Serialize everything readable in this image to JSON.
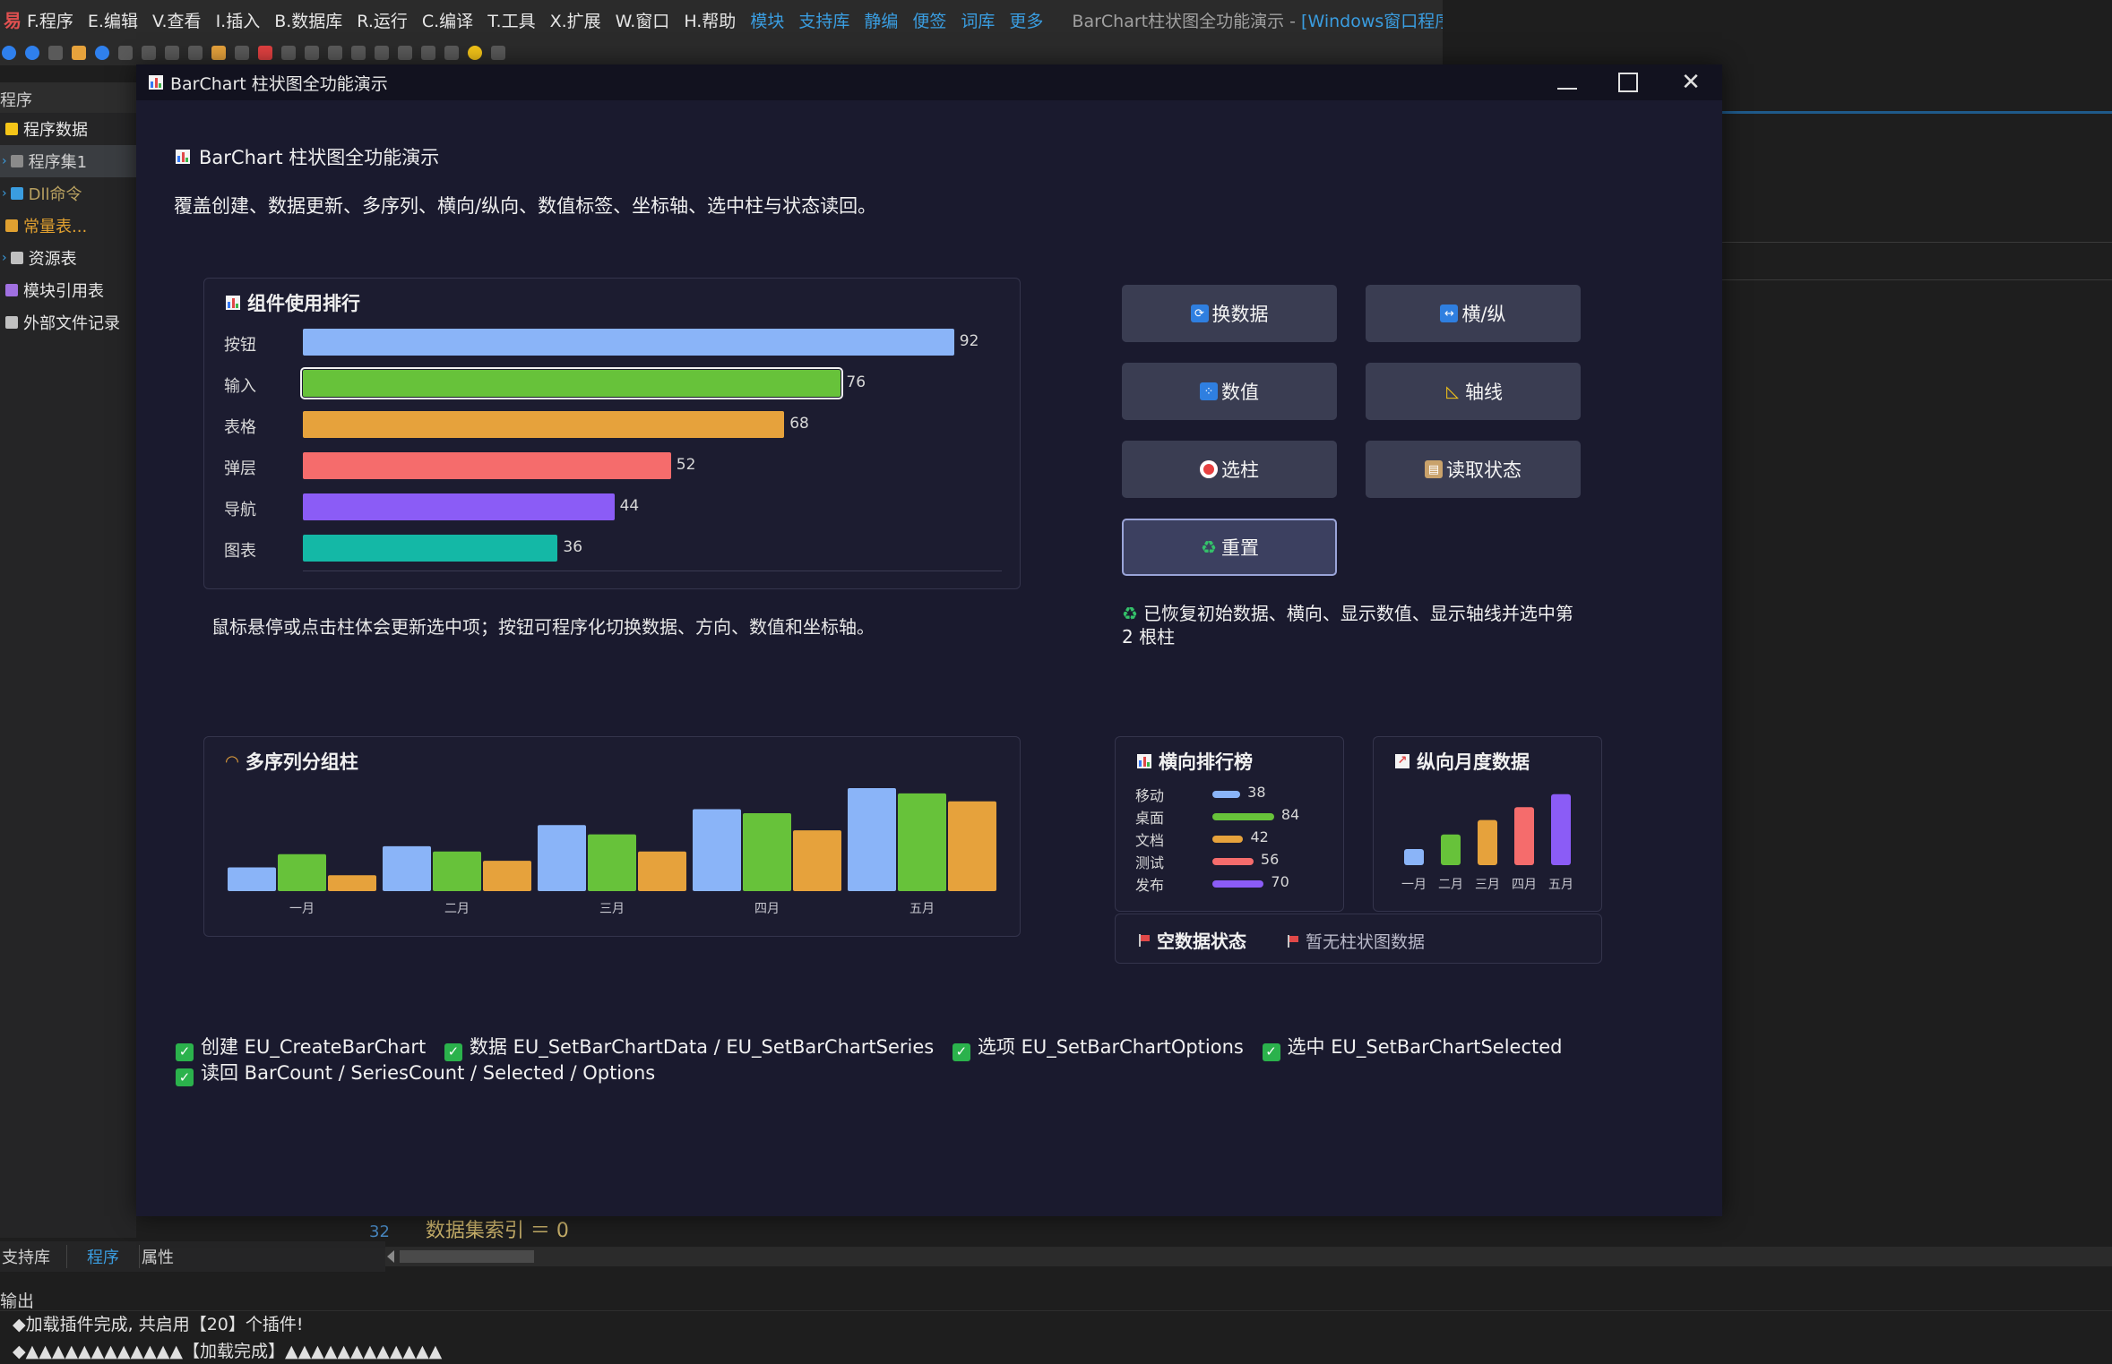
{
  "ide": {
    "menu": [
      "F.程序",
      "E.编辑",
      "V.查看",
      "I.插入",
      "B.数据库",
      "R.运行",
      "C.编译",
      "T.工具",
      "X.扩展",
      "W.窗口",
      "H.帮助"
    ],
    "menu_blue": [
      "模块",
      "支持库",
      "静编",
      "便签",
      "词库",
      "更多"
    ],
    "window_title": "BarChart柱状图全功能演示 - ",
    "window_title_blue": "[Windows窗口程序]",
    "left_header": "程序",
    "tree": [
      {
        "label": "程序数据",
        "color": "#e6e6e6"
      },
      {
        "label": "程序集1",
        "color": "#d0d0d0"
      },
      {
        "label": "Dll命令",
        "color": "#b8a060"
      },
      {
        "label": "常量表...",
        "color": "#e0a030"
      },
      {
        "label": "资源表",
        "color": "#e6e6e6"
      },
      {
        "label": "模块引用表",
        "color": "#e6e6e6"
      },
      {
        "label": "外部文件记录",
        "color": "#e6e6e6"
      }
    ],
    "bottom_tabs": [
      "支持库",
      "程序",
      "属性"
    ],
    "code_peek": {
      "line": "32",
      "text": "数据集索引 ＝ 0"
    },
    "output_title": "输出",
    "output_lines": [
      "◆加载插件完成, 共启用【20】个插件!",
      "◆▲▲▲▲▲▲▲▲▲▲▲▲【加载完成】▲▲▲▲▲▲▲▲▲▲▲▲"
    ]
  },
  "dialog": {
    "title": "BarChart 柱状图全功能演示",
    "heading": "BarChart 柱状图全功能演示",
    "subtitle": "覆盖创建、数据更新、多序列、横向/纵向、数值标签、坐标轴、选中柱与状态读回。",
    "hint": "鼠标悬停或点击柱体会更新选中项；按钮可程序化切换数据、方向、数值和坐标轴。",
    "buttons": {
      "swap_data": "换数据",
      "orientation": "横/纵",
      "values": "数值",
      "axis": "轴线",
      "select_bar": "选柱",
      "read_state": "读取状态",
      "reset": "重置"
    },
    "status_message": "已恢复初始数据、横向、显示数值、显示轴线并选中第 2 根柱",
    "empty_title": "空数据状态",
    "empty_text": "暂无柱状图数据",
    "api": {
      "create": "创建 EU_CreateBarChart",
      "data": "数据 EU_SetBarChartData / EU_SetBarChartSeries",
      "options": "选项 EU_SetBarChartOptions",
      "selected": "选中 EU_SetBarChartSelected",
      "readback": "读回 BarCount / SeriesCount / Selected / Options"
    }
  },
  "chart_data": [
    {
      "type": "bar",
      "orientation": "horizontal",
      "title": "组件使用排行",
      "categories": [
        "按钮",
        "输入",
        "表格",
        "弹层",
        "导航",
        "图表"
      ],
      "values": [
        92,
        76,
        68,
        52,
        44,
        36
      ],
      "colors": [
        "#8ab4f8",
        "#67c23a",
        "#e6a23c",
        "#f56c6c",
        "#8b5cf6",
        "#14b8a6"
      ],
      "selected_index": 1,
      "xlim": [
        0,
        100
      ],
      "show_values": true,
      "axis": true
    },
    {
      "type": "bar",
      "orientation": "vertical",
      "title": "多序列分组柱",
      "categories": [
        "一月",
        "二月",
        "三月",
        "四月",
        "五月"
      ],
      "series": [
        {
          "values": [
            18,
            34,
            50,
            62,
            78
          ],
          "color": "#8ab4f8"
        },
        {
          "values": [
            28,
            30,
            43,
            59,
            74
          ],
          "color": "#67c23a"
        },
        {
          "values": [
            12,
            23,
            30,
            46,
            68
          ],
          "color": "#e6a23c"
        }
      ],
      "ylim": [
        0,
        80
      ],
      "show_values": false
    },
    {
      "type": "bar",
      "orientation": "horizontal",
      "title": "横向排行榜",
      "categories": [
        "移动",
        "桌面",
        "文档",
        "测试",
        "发布"
      ],
      "values": [
        38,
        84,
        42,
        56,
        70
      ],
      "colors": [
        "#8ab4f8",
        "#67c23a",
        "#e6a23c",
        "#f56c6c",
        "#8b5cf6"
      ],
      "xlim": [
        0,
        100
      ],
      "show_values": true
    },
    {
      "type": "bar",
      "orientation": "vertical",
      "title": "纵向月度数据",
      "categories": [
        "一月",
        "二月",
        "三月",
        "四月",
        "五月"
      ],
      "values": [
        20,
        38,
        56,
        72,
        88
      ],
      "colors": [
        "#8ab4f8",
        "#67c23a",
        "#e6a23c",
        "#f56c6c",
        "#8b5cf6"
      ],
      "ylim": [
        0,
        100
      ],
      "show_values": false
    }
  ]
}
